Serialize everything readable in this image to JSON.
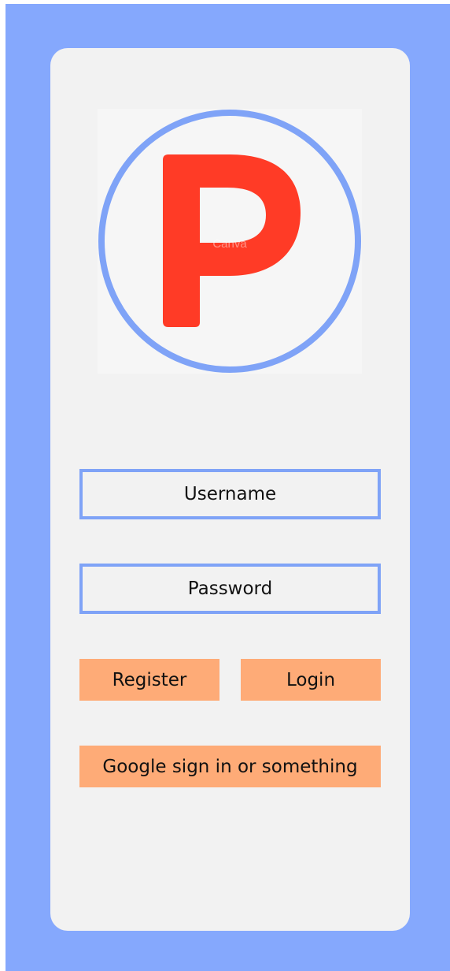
{
  "login": {
    "logo": {
      "letter": "P",
      "watermark": "Canva",
      "ring_color": "#7fa3f7",
      "letter_color": "#ff3b26"
    },
    "username_field": {
      "placeholder": "Username"
    },
    "password_field": {
      "placeholder": "Password"
    },
    "register_button": {
      "label": "Register"
    },
    "login_button": {
      "label": "Login"
    },
    "google_button": {
      "label": "Google sign in or something"
    }
  },
  "colors": {
    "background": "#85a8fd",
    "card": "#f2f2f2",
    "accent": "#feab77"
  }
}
